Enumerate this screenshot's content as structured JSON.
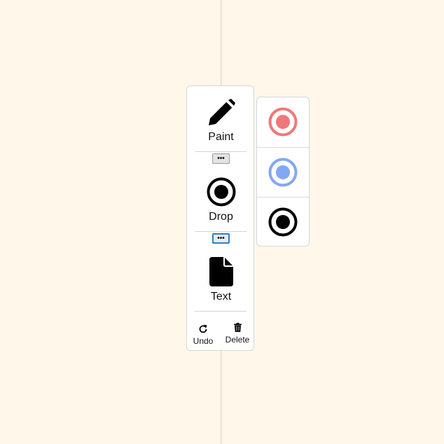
{
  "toolbar": {
    "tools": [
      {
        "label": "Paint",
        "icon": "pencil-icon"
      },
      {
        "label": "Drop",
        "icon": "target-icon"
      },
      {
        "label": "Text",
        "icon": "file-icon"
      }
    ],
    "more_label": "•••",
    "undo_label": "Undo",
    "delete_label": "Delete"
  },
  "palette": {
    "swatches": [
      {
        "color": "#f07878",
        "icon": "target-icon"
      },
      {
        "color": "#82a8f5",
        "icon": "target-icon"
      },
      {
        "color": "#000000",
        "icon": "target-icon"
      }
    ]
  }
}
